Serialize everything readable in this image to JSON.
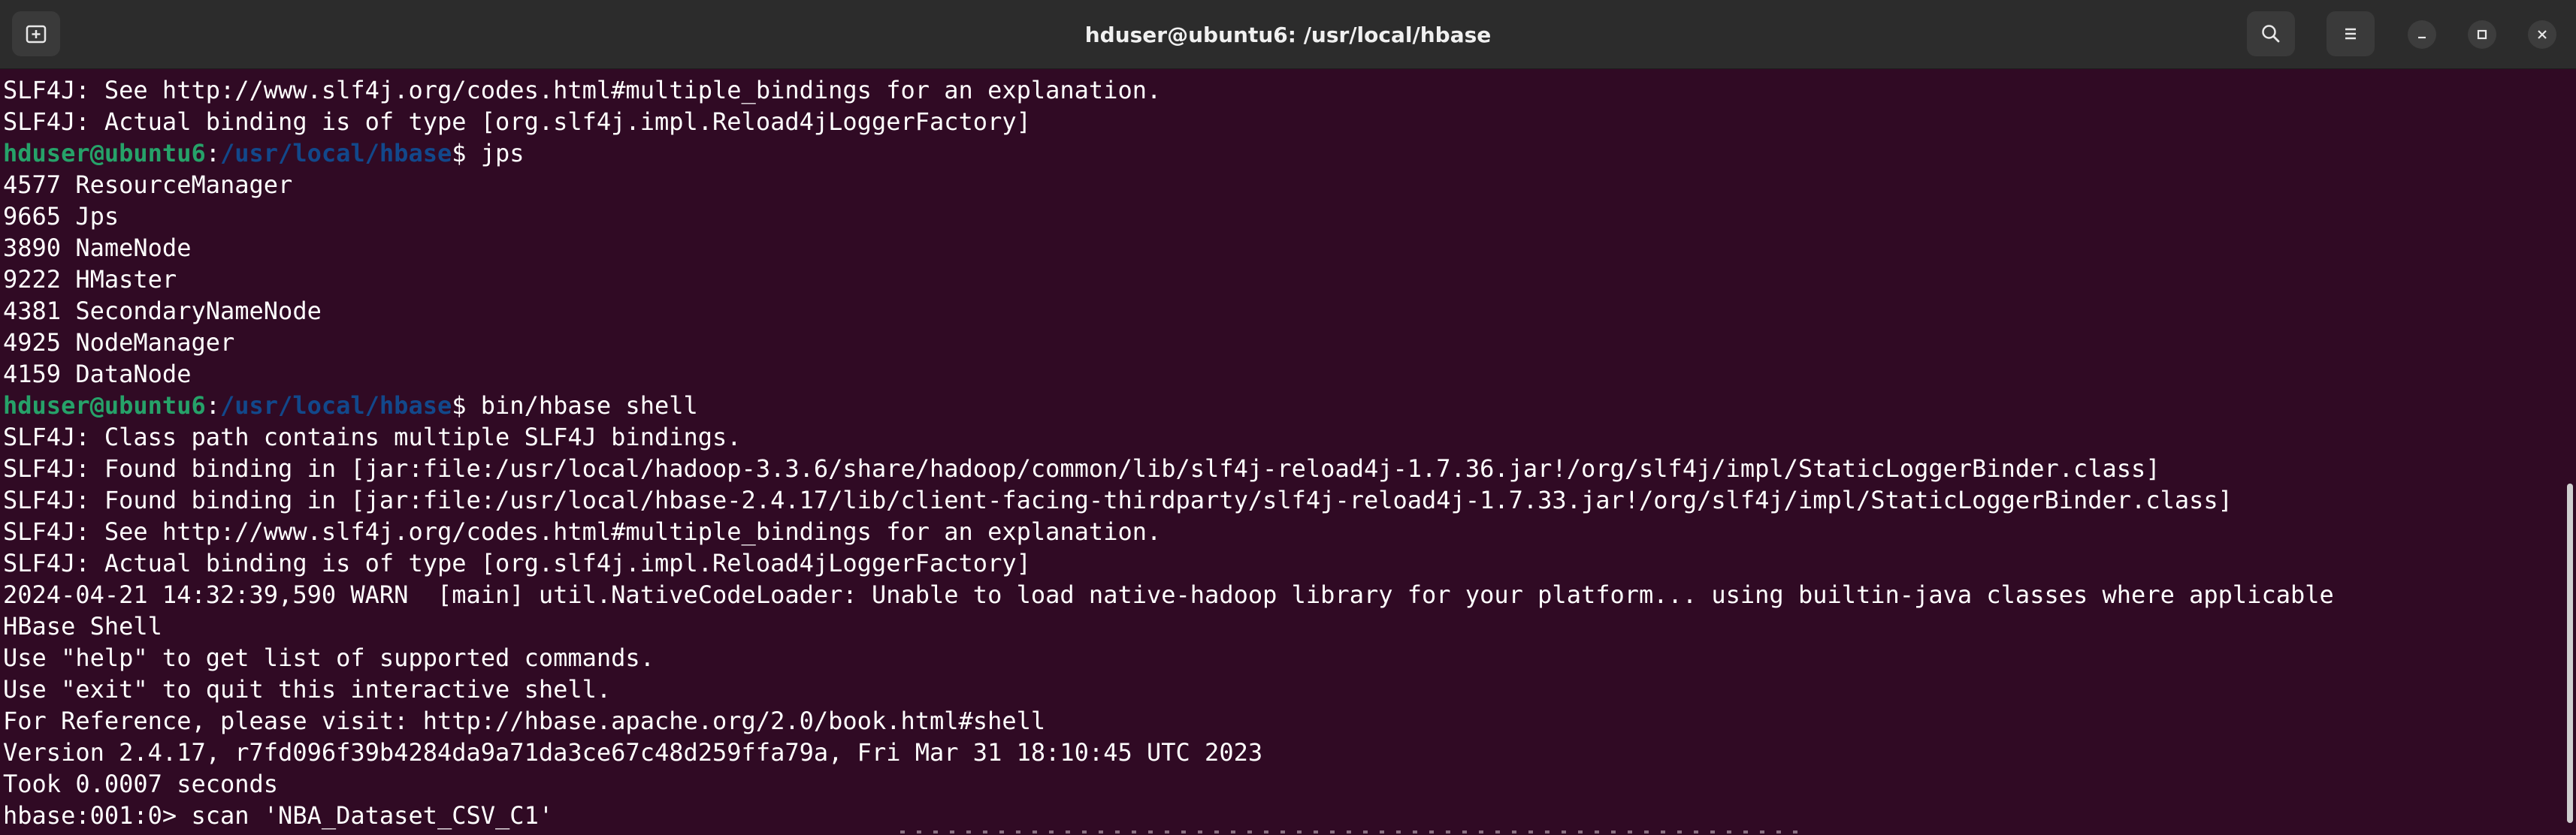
{
  "window": {
    "title": "hduser@ubuntu6: /usr/local/hbase"
  },
  "icons": {
    "new_tab": "new-tab-icon",
    "search": "search-icon",
    "menu": "hamburger-menu-icon",
    "minimize": "minimize-icon",
    "maximize": "maximize-icon",
    "close": "close-icon"
  },
  "colors": {
    "terminal_bg": "#300a24",
    "prompt_user": "#26a269",
    "prompt_path": "#12488b",
    "text": "#ffffff"
  },
  "prompt": {
    "user": "hduser@ubuntu6",
    "sep": ":",
    "path": "/usr/local/hbase",
    "symbol": "$"
  },
  "terminal": {
    "lines": [
      "SLF4J: See http://www.slf4j.org/codes.html#multiple_bindings for an explanation.",
      "SLF4J: Actual binding is of type [org.slf4j.impl.Reload4jLoggerFactory]",
      "",
      "4577 ResourceManager",
      "9665 Jps",
      "3890 NameNode",
      "9222 HMaster",
      "4381 SecondaryNameNode",
      "4925 NodeManager",
      "4159 DataNode",
      "",
      "SLF4J: Class path contains multiple SLF4J bindings.",
      "SLF4J: Found binding in [jar:file:/usr/local/hadoop-3.3.6/share/hadoop/common/lib/slf4j-reload4j-1.7.36.jar!/org/slf4j/impl/StaticLoggerBinder.class]",
      "SLF4J: Found binding in [jar:file:/usr/local/hbase-2.4.17/lib/client-facing-thirdparty/slf4j-reload4j-1.7.33.jar!/org/slf4j/impl/StaticLoggerBinder.class]",
      "SLF4J: See http://www.slf4j.org/codes.html#multiple_bindings for an explanation.",
      "SLF4J: Actual binding is of type [org.slf4j.impl.Reload4jLoggerFactory]",
      "2024-04-21 14:32:39,590 WARN  [main] util.NativeCodeLoader: Unable to load native-hadoop library for your platform... using builtin-java classes where applicable",
      "HBase Shell",
      "Use \"help\" to get list of supported commands.",
      "Use \"exit\" to quit this interactive shell.",
      "For Reference, please visit: http://hbase.apache.org/2.0/book.html#shell",
      "Version 2.4.17, r7fd096f39b4284da9a71da3ce67c48d259ffa79a, Fri Mar 31 18:10:45 UTC 2023",
      "Took 0.0007 seconds",
      "hbase:001:0> scan 'NBA_Dataset_CSV_C1'"
    ],
    "commands": {
      "cmd1": " jps",
      "cmd2": " bin/hbase shell"
    }
  }
}
